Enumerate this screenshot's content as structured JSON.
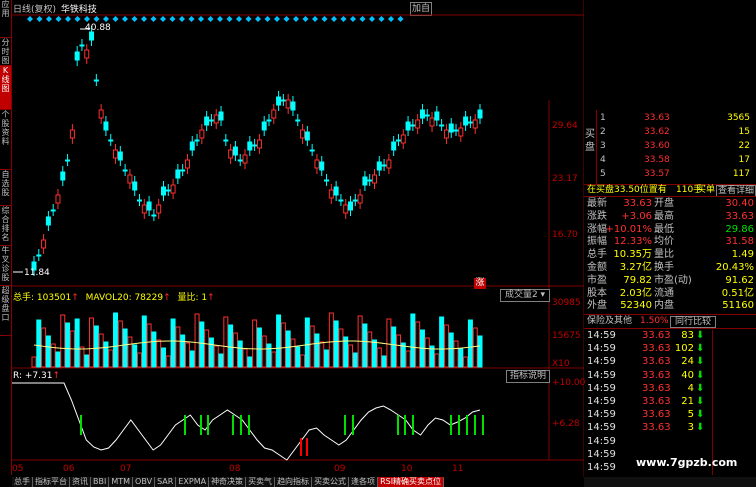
{
  "header": {
    "label": "日线(复权)",
    "stock": "华铁科技",
    "add_label": "加自"
  },
  "left_tabs": [
    "应用",
    "分时图",
    "K线图",
    "个股资料",
    "自选股",
    "综合排名",
    "牛叉诊股",
    "超级盘口"
  ],
  "left_tab_active": 2,
  "price_panel": {
    "high_label": "40.88",
    "low_label": "11.84",
    "axis_labels": [
      "29.64",
      "23.17",
      "16.70"
    ],
    "up_marker": "涨"
  },
  "volume_panel": {
    "indicator": "总手: 103501",
    "mavol": "MAVOL20: 78229",
    "ratio": "量比: 1",
    "select_label": "成交量2",
    "axis_labels": [
      "30985",
      "15675",
      "X10"
    ]
  },
  "rsi_panel": {
    "indicator": "R: +7.31",
    "explain_label": "指标说明",
    "axis_labels": [
      "+10.00",
      "+6.28"
    ]
  },
  "date_axis": [
    "05",
    "06",
    "07",
    "08",
    "09",
    "10",
    "11"
  ],
  "quotes": {
    "buy_label": "买盘",
    "rows": [
      {
        "level": "1",
        "price": "33.63",
        "vol": "3565"
      },
      {
        "level": "2",
        "price": "33.62",
        "vol": "15"
      },
      {
        "level": "3",
        "price": "33.60",
        "vol": "22"
      },
      {
        "level": "4",
        "price": "33.58",
        "vol": "17"
      },
      {
        "level": "5",
        "price": "33.57",
        "vol": "117"
      }
    ],
    "position_line": "在买盘33.50位置有",
    "position_vol": "110手",
    "buy_one": "买单!",
    "detail_btn": "查看详细"
  },
  "stats": [
    {
      "l1": "最新",
      "v1": "33.63",
      "l2": "开盘",
      "v2": "30.40"
    },
    {
      "l1": "涨跌",
      "v1": "+3.06",
      "l2": "最高",
      "v2": "33.63"
    },
    {
      "l1": "涨幅",
      "v1": "+10.01%",
      "l2": "最低",
      "v2": "29.86"
    },
    {
      "l1": "振幅",
      "v1": "12.33%",
      "l2": "均价",
      "v2": "31.58"
    },
    {
      "l1": "总手",
      "v1": "10.35万",
      "l2": "量比",
      "v2": "1.49"
    },
    {
      "l1": "金额",
      "v1": "3.27亿",
      "l2": "换手",
      "v2": "20.43%"
    },
    {
      "l1": "市盈",
      "v1": "79.82",
      "l2": "市盈(动)",
      "v2": "91.62"
    },
    {
      "l1": "股本",
      "v1": "2.03亿",
      "l2": "流通",
      "v2": "0.51亿"
    },
    {
      "l1": "外盘",
      "v1": "52340",
      "l2": "内盘",
      "v2": "51160"
    }
  ],
  "sector": {
    "name": "保险及其他",
    "pct": "1.50%",
    "compare": "同行比较"
  },
  "ticks": [
    {
      "time": "14:59",
      "price": "33.63",
      "vol": "83"
    },
    {
      "time": "14:59",
      "price": "33.63",
      "vol": "102"
    },
    {
      "time": "14:59",
      "price": "33.63",
      "vol": "24"
    },
    {
      "time": "14:59",
      "price": "33.63",
      "vol": "40"
    },
    {
      "time": "14:59",
      "price": "33.63",
      "vol": "4"
    },
    {
      "time": "14:59",
      "price": "33.63",
      "vol": "21"
    },
    {
      "time": "14:59",
      "price": "33.63",
      "vol": "5"
    },
    {
      "time": "14:59",
      "price": "33.63",
      "vol": "3"
    },
    {
      "time": "14:59",
      "price": "",
      "vol": ""
    },
    {
      "time": "14:59",
      "price": "",
      "vol": ""
    },
    {
      "time": "14:59",
      "price": "",
      "vol": ""
    }
  ],
  "bottom_tabs": [
    "总手",
    "指标平台",
    "资讯",
    "BBI",
    "MTM",
    "OBV",
    "SAR",
    "EXPMA",
    "神奇决策",
    "买卖气",
    "趋向指标",
    "买卖公式",
    "逢各项",
    "RSI精确买卖点位"
  ],
  "bottom_tab_active": 13,
  "watermark": "www.7gpzb.com",
  "colors": {
    "up": "#ff3030",
    "down": "#00ffff",
    "grid": "#800000",
    "signal_up": "#00e000",
    "signal_down": "#ff0000"
  }
}
